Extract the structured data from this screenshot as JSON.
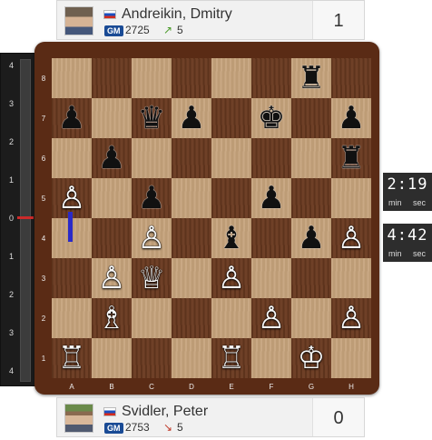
{
  "players": {
    "top": {
      "name": "Andreikin, Dmitry",
      "title": "GM",
      "rating": "2725",
      "trend": "↗",
      "change": "5",
      "score": "1",
      "flag": "Russia"
    },
    "bottom": {
      "name": "Svidler, Peter",
      "title": "GM",
      "rating": "2753",
      "trend": "↘",
      "change": "5",
      "score": "0",
      "flag": "Russia"
    }
  },
  "eval_bar": {
    "labels": [
      "4",
      "3",
      "2",
      "1",
      "0",
      "1",
      "2",
      "3",
      "4"
    ],
    "value": 0
  },
  "board": {
    "files": [
      "A",
      "B",
      "C",
      "D",
      "E",
      "F",
      "G",
      "H"
    ],
    "ranks": [
      "8",
      "7",
      "6",
      "5",
      "4",
      "3",
      "2",
      "1"
    ],
    "last_move": {
      "from": "a4",
      "to": "a5"
    },
    "pieces": [
      {
        "square": "g8",
        "color": "b",
        "type": "rook",
        "glyph": "♜"
      },
      {
        "square": "a7",
        "color": "b",
        "type": "pawn",
        "glyph": "♟"
      },
      {
        "square": "c7",
        "color": "b",
        "type": "queen",
        "glyph": "♛"
      },
      {
        "square": "d7",
        "color": "b",
        "type": "pawn",
        "glyph": "♟"
      },
      {
        "square": "f7",
        "color": "b",
        "type": "king",
        "glyph": "♚"
      },
      {
        "square": "h7",
        "color": "b",
        "type": "pawn",
        "glyph": "♟"
      },
      {
        "square": "b6",
        "color": "b",
        "type": "pawn",
        "glyph": "♟"
      },
      {
        "square": "h6",
        "color": "b",
        "type": "rook",
        "glyph": "♜"
      },
      {
        "square": "a5",
        "color": "w",
        "type": "pawn",
        "glyph": "♙"
      },
      {
        "square": "c5",
        "color": "b",
        "type": "pawn",
        "glyph": "♟"
      },
      {
        "square": "f5",
        "color": "b",
        "type": "pawn",
        "glyph": "♟"
      },
      {
        "square": "c4",
        "color": "w",
        "type": "pawn",
        "glyph": "♙"
      },
      {
        "square": "e4",
        "color": "b",
        "type": "bishop",
        "glyph": "♝"
      },
      {
        "square": "g4",
        "color": "b",
        "type": "pawn",
        "glyph": "♟"
      },
      {
        "square": "h4",
        "color": "w",
        "type": "pawn",
        "glyph": "♙"
      },
      {
        "square": "b3",
        "color": "w",
        "type": "pawn",
        "glyph": "♙"
      },
      {
        "square": "c3",
        "color": "w",
        "type": "queen",
        "glyph": "♕"
      },
      {
        "square": "e3",
        "color": "w",
        "type": "pawn",
        "glyph": "♙"
      },
      {
        "square": "b2",
        "color": "w",
        "type": "bishop",
        "glyph": "♗"
      },
      {
        "square": "f2",
        "color": "w",
        "type": "pawn",
        "glyph": "♙"
      },
      {
        "square": "h2",
        "color": "w",
        "type": "pawn",
        "glyph": "♙"
      },
      {
        "square": "a1",
        "color": "w",
        "type": "rook",
        "glyph": "♖"
      },
      {
        "square": "e1",
        "color": "w",
        "type": "rook",
        "glyph": "♖"
      },
      {
        "square": "g1",
        "color": "w",
        "type": "king",
        "glyph": "♔"
      }
    ]
  },
  "clocks": {
    "top": {
      "time": "2:19",
      "min_label": "min",
      "sec_label": "sec"
    },
    "bottom": {
      "time": "4:42",
      "min_label": "min",
      "sec_label": "sec"
    }
  },
  "colors": {
    "light_square": "#c5a27b",
    "dark_square": "#6a3a20",
    "frame": "#5a2b15",
    "move_arrow": "#2a2ac8",
    "eval_zero": "#cc2a2a"
  }
}
